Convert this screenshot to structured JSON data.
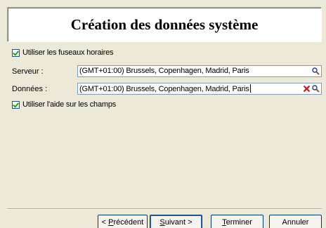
{
  "dialog": {
    "title": "Création des données système"
  },
  "options": {
    "use_timezones": {
      "label": "Utiliser les fuseaux horaires",
      "checked": true
    },
    "use_field_help": {
      "label": "Utiliser l'aide sur les champs",
      "checked": true
    }
  },
  "fields": {
    "server": {
      "label": "Serveur :",
      "value": "(GMT+01:00) Brussels, Copenhagen, Madrid, Paris",
      "search_icon": "magnifier-icon"
    },
    "data": {
      "label": "Données :",
      "value": "(GMT+01:00) Brussels, Copenhagen, Madrid, Paris",
      "clear_icon": "red-x-icon",
      "search_icon": "magnifier-icon"
    }
  },
  "buttons": {
    "previous": {
      "prefix": "< ",
      "mnemonic": "P",
      "rest": "récédent"
    },
    "next": {
      "mnemonic": "S",
      "rest": "uivant",
      "suffix": " >"
    },
    "finish": {
      "mnemonic": "T",
      "rest": "erminer"
    },
    "cancel": {
      "label": "Annuler"
    }
  },
  "colors": {
    "window_bg": "#ece9d8",
    "field_border": "#7f9db9",
    "checkmark": "#21a121",
    "clear_icon": "#e01010",
    "default_button_ring": "#316ac5"
  }
}
